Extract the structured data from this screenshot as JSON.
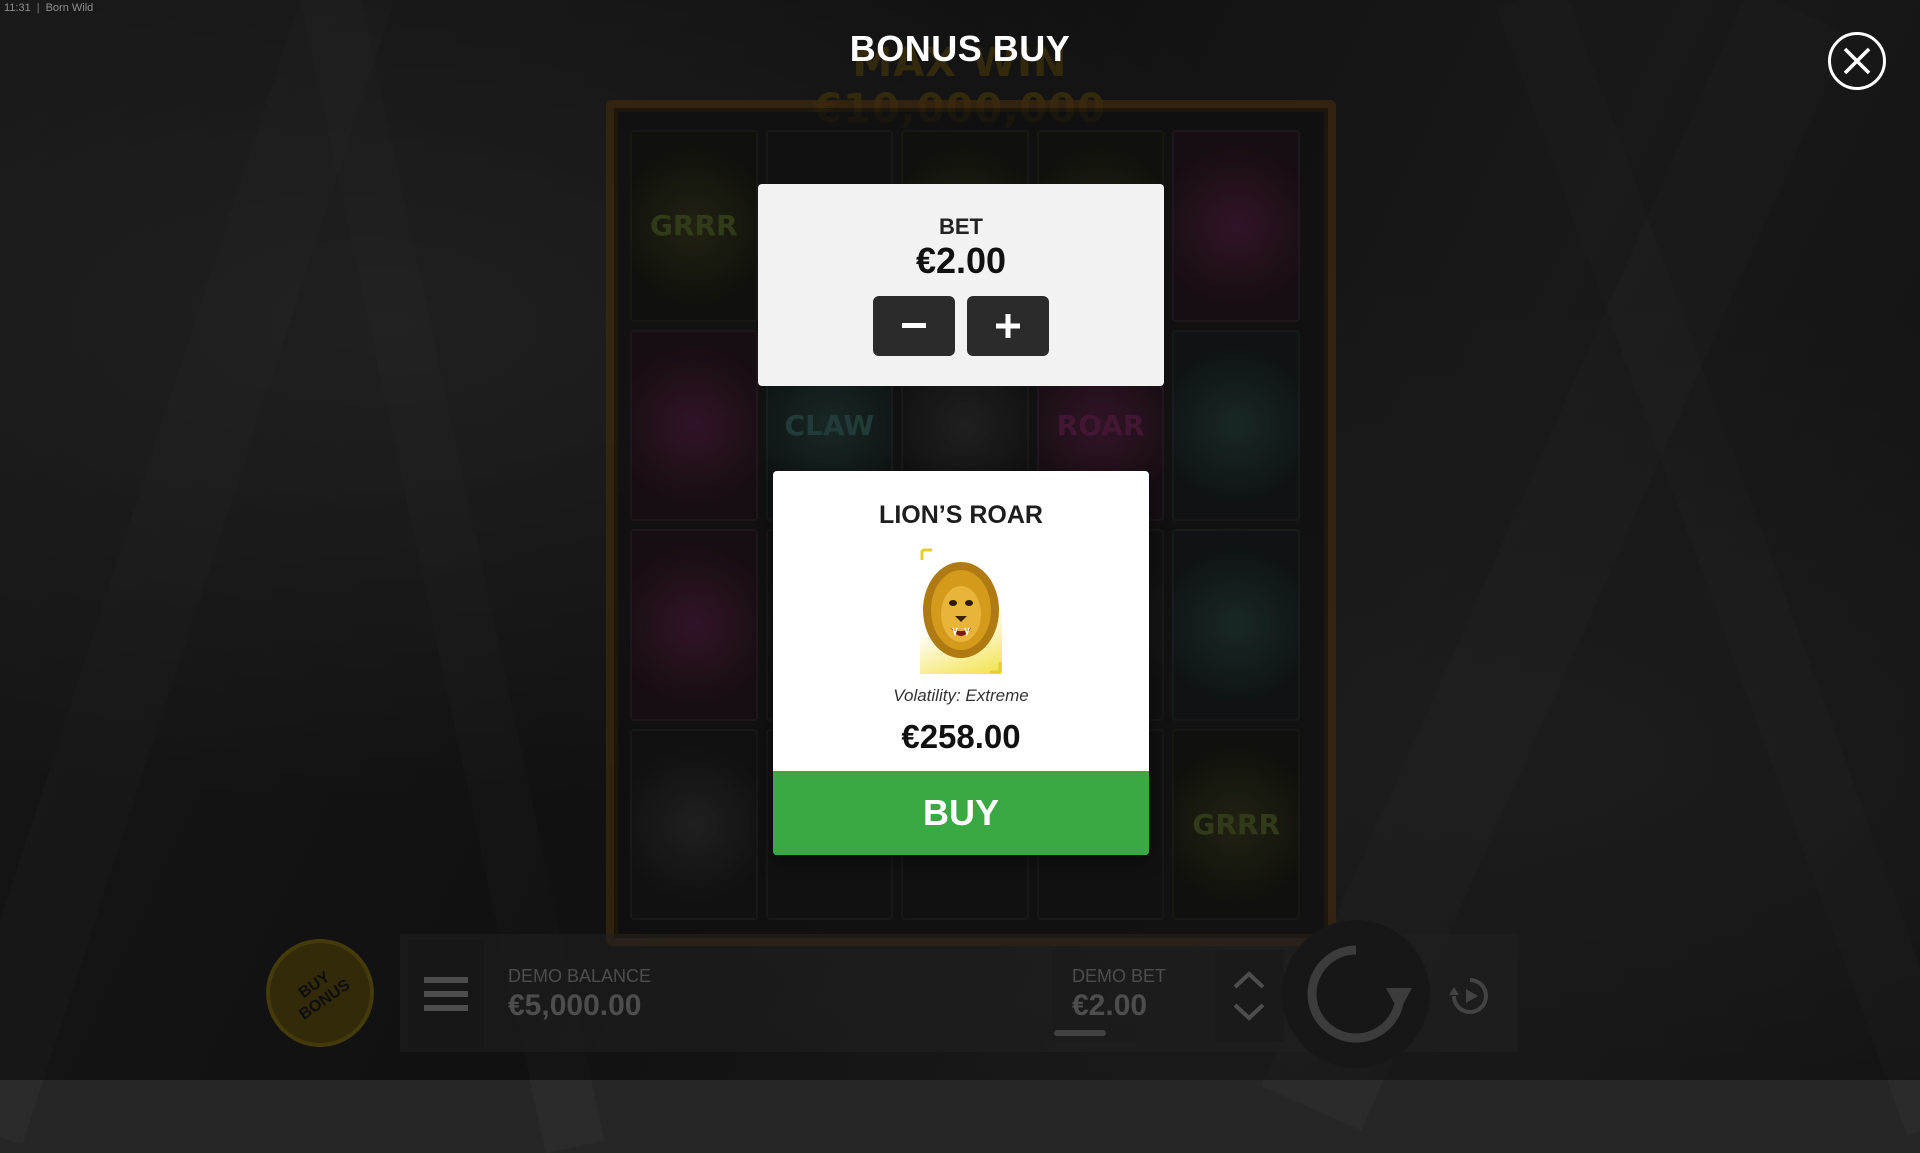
{
  "status_bar": {
    "time": "11:31",
    "title": "Born Wild"
  },
  "background": {
    "max_win_banner": "MAX WIN €10,000,000",
    "reel_symbols": [
      "GRRR",
      "",
      "",
      "",
      "",
      "",
      "CLAW",
      "",
      "ROAR",
      "",
      "",
      "",
      "",
      "",
      "",
      "",
      "",
      "",
      "",
      "GRRR"
    ]
  },
  "modal": {
    "title": "BONUS BUY",
    "close_icon": "close-icon",
    "bet_panel": {
      "label": "BET",
      "value": "€2.00",
      "decrease_icon": "minus-icon",
      "increase_icon": "plus-icon"
    },
    "bonus_card": {
      "title": "LION’S ROAR",
      "image_icon": "lion-icon",
      "volatility": "Volatility: Extreme",
      "price": "€258.00",
      "buy_label": "BUY"
    }
  },
  "bottom_bar": {
    "buy_bonus_label": "BUY BONUS",
    "menu_icon": "menu-icon",
    "balance_label": "DEMO BALANCE",
    "balance_value": "€5,000.00",
    "bet_label": "DEMO BET",
    "bet_value": "€2.00",
    "bet_up_icon": "chevron-up-icon",
    "bet_down_icon": "chevron-down-icon",
    "spin_icon": "spin-icon",
    "autoplay_icon": "autoplay-icon"
  },
  "colors": {
    "buy_green": "#3aa843",
    "bonus_gold": "#5b4d10",
    "panel_light": "#f2f2f2"
  }
}
